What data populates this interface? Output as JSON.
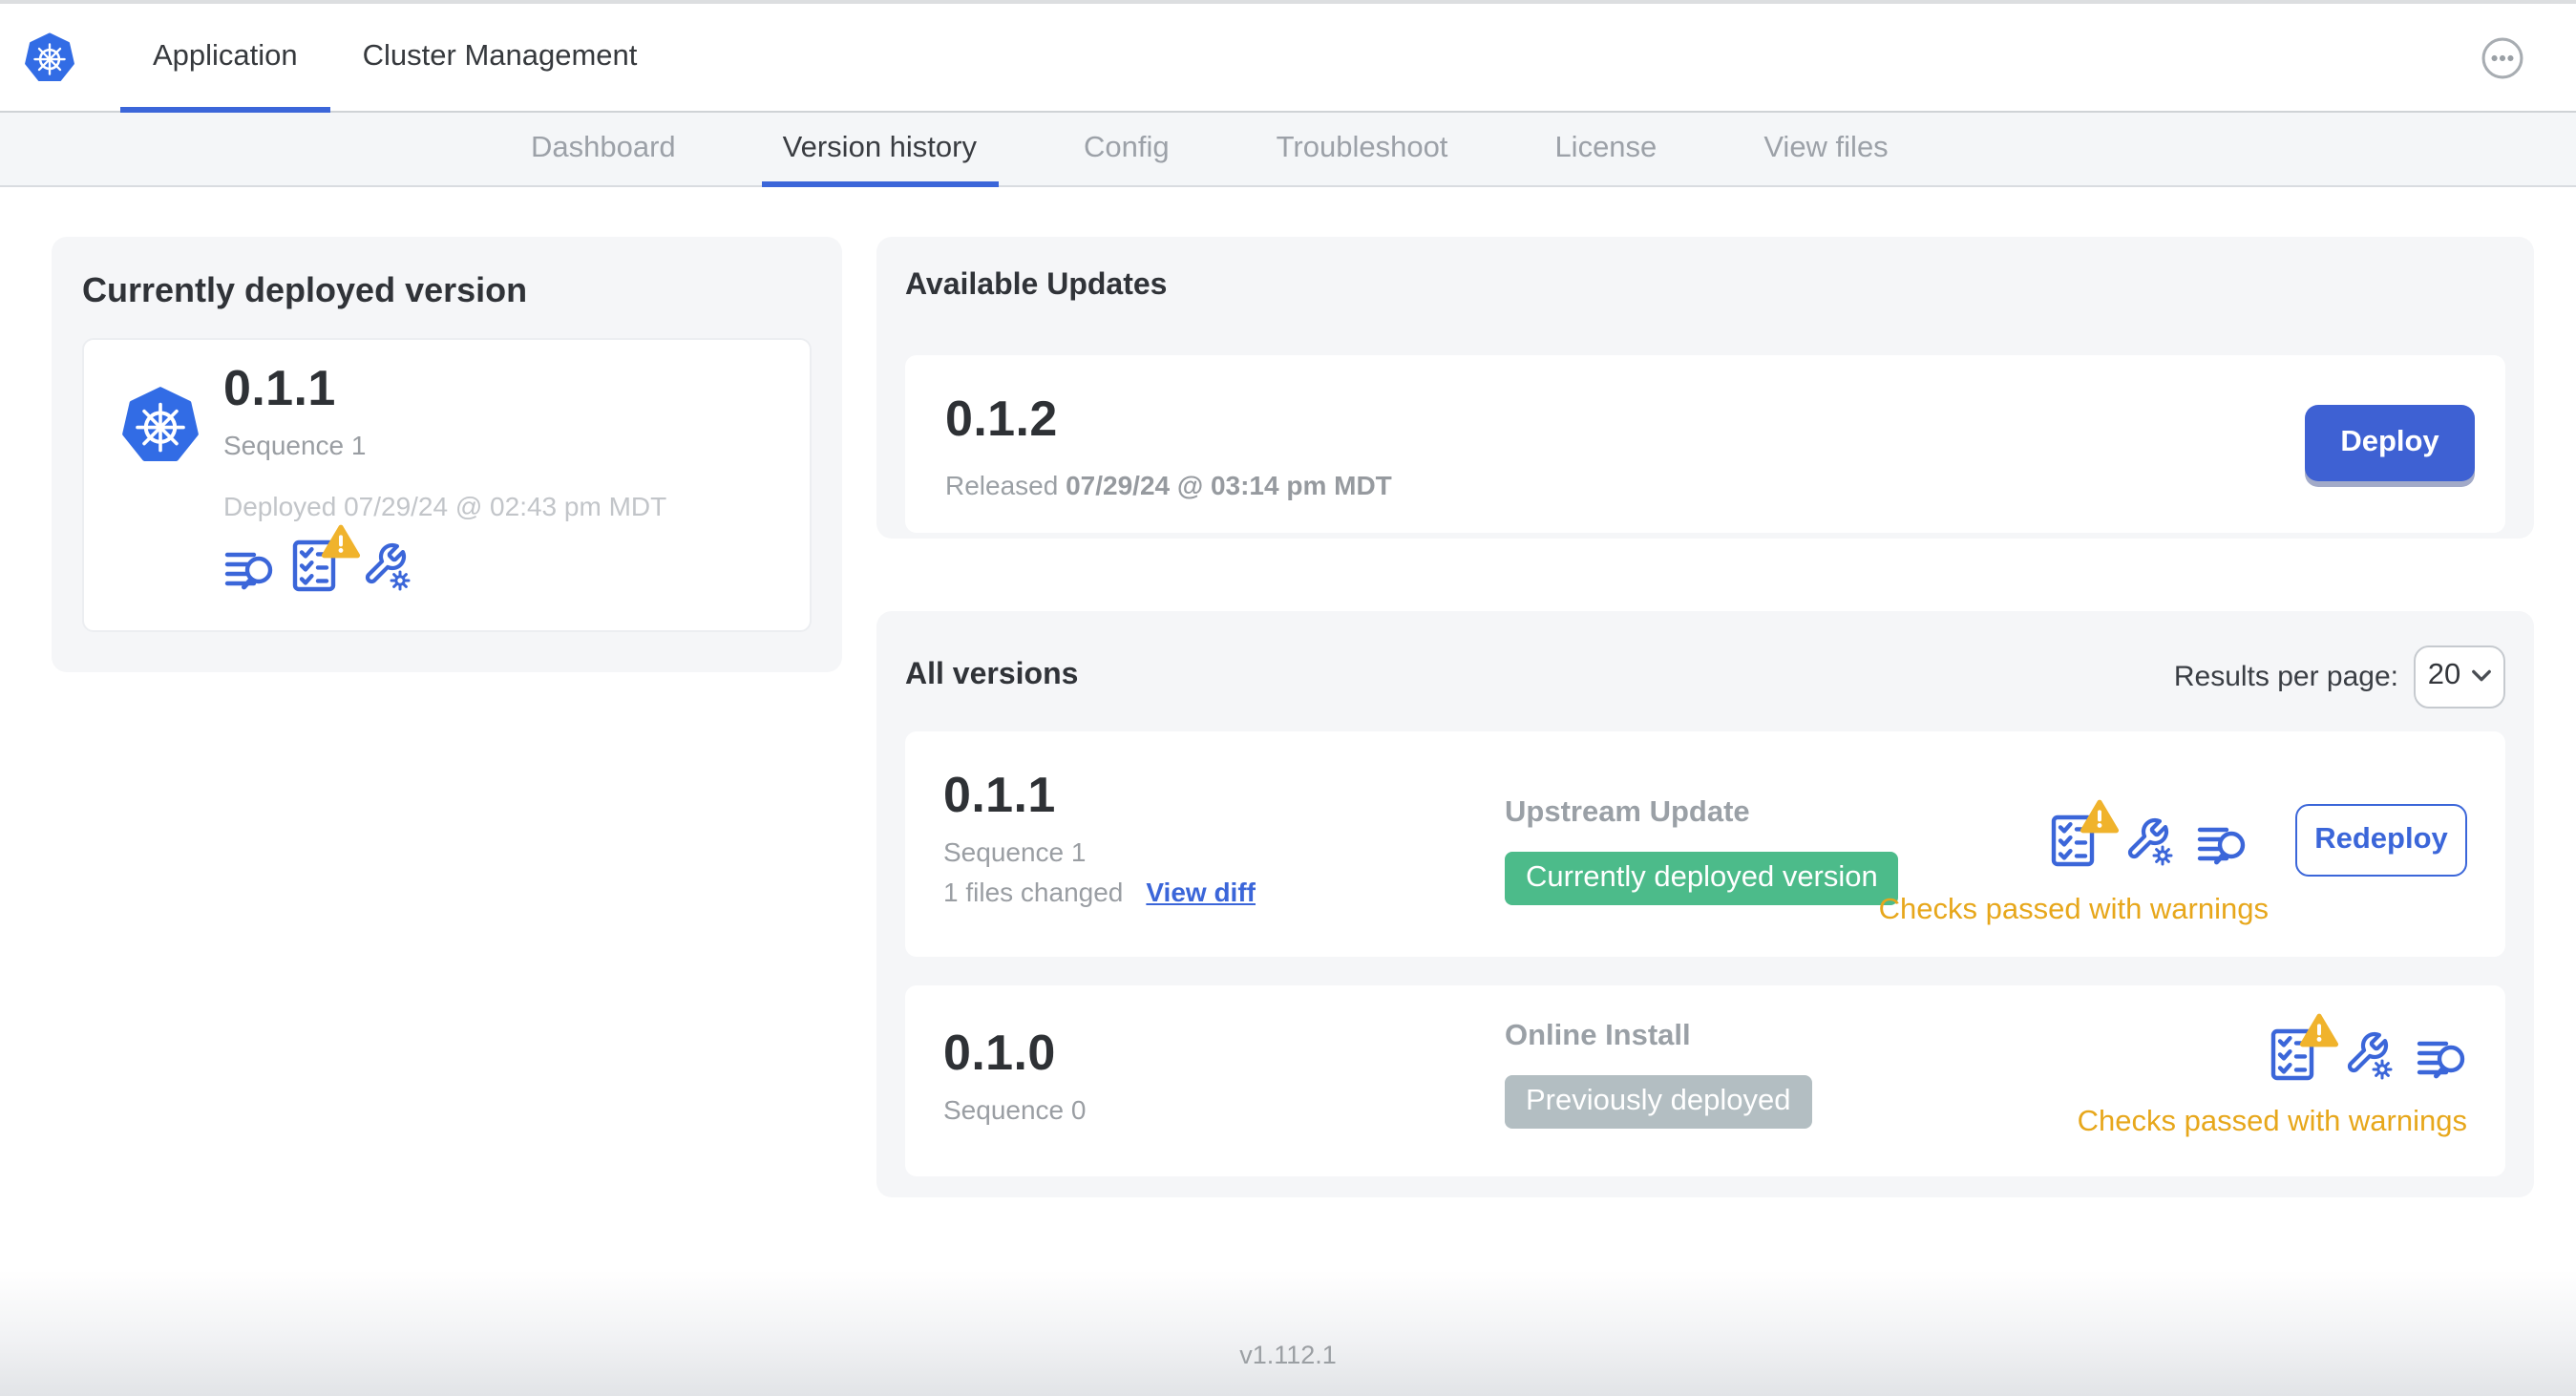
{
  "colors": {
    "primary_blue": "#3b66d9",
    "k8s_logo_blue": "#326ce5",
    "deploy_button_blue": "#3e61d3",
    "badge_green": "#4cbb8a",
    "badge_gray": "#b3bec2",
    "warning_amber": "#f0b32c",
    "status_amber_text": "#e7a71b",
    "card_background": "#f5f6f8"
  },
  "topnav": {
    "tabs": [
      "Application",
      "Cluster Management"
    ],
    "active_tab": "Application",
    "more_menu_icon": "ellipsis-circle-icon"
  },
  "subnav": {
    "tabs": [
      "Dashboard",
      "Version history",
      "Config",
      "Troubleshoot",
      "License",
      "View files"
    ],
    "active_tab": "Version history"
  },
  "current_version_card": {
    "title": "Currently deployed version",
    "logo_icon": "kubernetes-logo",
    "version": "0.1.1",
    "sequence": "Sequence 1",
    "deployed": "Deployed 07/29/24 @ 02:43 pm MDT",
    "icons": [
      "diff-logs-icon",
      "preflight-checks-warning-icon",
      "config-icon"
    ]
  },
  "available_updates": {
    "title": "Available Updates",
    "version": "0.1.2",
    "released_label": "Released",
    "released_value": "07/29/24 @ 03:14 pm MDT",
    "deploy_button_label": "Deploy"
  },
  "all_versions": {
    "title": "All versions",
    "results_per_page_label": "Results per page:",
    "results_per_page_value": "20",
    "rows": [
      {
        "version": "0.1.1",
        "sequence": "Sequence 1",
        "files_changed": "1 files changed",
        "view_diff_label": "View diff",
        "source": "Upstream Update",
        "badge_label": "Currently deployed version",
        "badge_color": "#4cbb8a",
        "icons": [
          "preflight-checks-warning-icon",
          "config-icon",
          "diff-logs-icon"
        ],
        "action_label": "Redeploy",
        "status": "Checks passed with warnings"
      },
      {
        "version": "0.1.0",
        "sequence": "Sequence 0",
        "source": "Online Install",
        "badge_label": "Previously deployed",
        "badge_color": "#b3bec2",
        "icons": [
          "preflight-checks-warning-icon",
          "config-icon",
          "diff-logs-icon"
        ],
        "status": "Checks passed with warnings"
      }
    ]
  },
  "footer": {
    "version": "v1.112.1"
  }
}
